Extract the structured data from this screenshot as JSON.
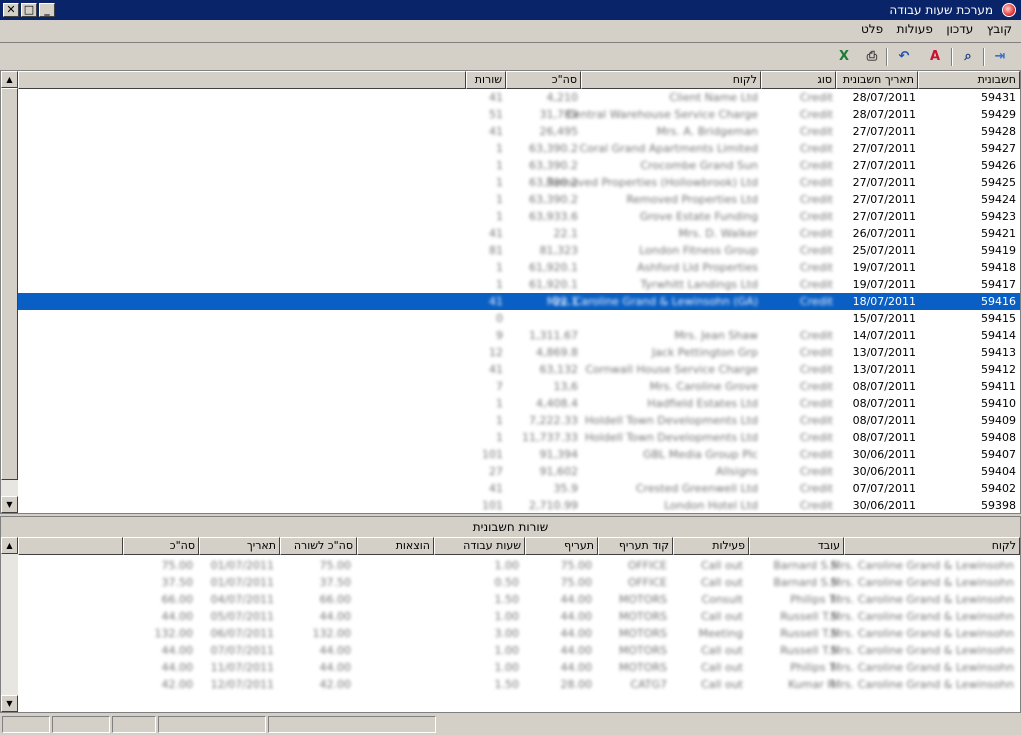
{
  "window": {
    "title": "מערכת שעות עבודה",
    "buttons": {
      "close": "✕",
      "maximize": "□",
      "minimize": "_"
    }
  },
  "menu": [
    "קובץ",
    "עדכון",
    "פעולות",
    "פלט"
  ],
  "toolbar": {
    "buttons": [
      {
        "name": "exit-icon",
        "glyph": "⇥",
        "color": "#3a6fc7"
      },
      {
        "name": "binoculars-icon",
        "glyph": "⌕",
        "color": "#1d3f7a"
      },
      {
        "name": "pdf-icon",
        "glyph": "A",
        "color": "#c8102e"
      },
      {
        "name": "undo-icon",
        "glyph": "↶",
        "color": "#1f4fb0"
      },
      {
        "name": "print-icon",
        "glyph": "⎙",
        "color": "#444444"
      },
      {
        "name": "excel-icon",
        "glyph": "X",
        "color": "#1e7b34"
      }
    ]
  },
  "invoices": {
    "columns": [
      "חשבונית",
      "תאריך חשבונית",
      "סוג",
      "לקוח",
      "סה\"כ",
      "שורות"
    ],
    "rows": [
      {
        "number": "59431",
        "date": "28/07/2011",
        "type": "Credit",
        "customer": "Client Name Ltd",
        "total": "4,210",
        "lines": "41"
      },
      {
        "number": "59429",
        "date": "28/07/2011",
        "type": "Credit",
        "customer": "Central Warehouse Service Charge",
        "total": "31,789",
        "lines": "51"
      },
      {
        "number": "59428",
        "date": "27/07/2011",
        "type": "Credit",
        "customer": "Mrs. A. Bridgeman",
        "total": "26,495",
        "lines": "41"
      },
      {
        "number": "59427",
        "date": "27/07/2011",
        "type": "Credit",
        "customer": "Coral Grand Apartments Limited",
        "total": "63,390.2",
        "lines": "1"
      },
      {
        "number": "59426",
        "date": "27/07/2011",
        "type": "Credit",
        "customer": "Crocombe Grand Sun",
        "total": "63,390.2",
        "lines": "1"
      },
      {
        "number": "59425",
        "date": "27/07/2011",
        "type": "Credit",
        "customer": "Removed Properties (Hollowbrook) Ltd",
        "total": "63,390.2",
        "lines": "1"
      },
      {
        "number": "59424",
        "date": "27/07/2011",
        "type": "Credit",
        "customer": "Removed Properties Ltd",
        "total": "63,390.2",
        "lines": "1"
      },
      {
        "number": "59423",
        "date": "27/07/2011",
        "type": "Credit",
        "customer": "Grove Estate Funding",
        "total": "63,933.6",
        "lines": "1"
      },
      {
        "number": "59421",
        "date": "26/07/2011",
        "type": "Credit",
        "customer": "Mrs. D. Walker",
        "total": "22.1",
        "lines": "41"
      },
      {
        "number": "59419",
        "date": "25/07/2011",
        "type": "Credit",
        "customer": "London Fitness Group",
        "total": "81,323",
        "lines": "81"
      },
      {
        "number": "59418",
        "date": "19/07/2011",
        "type": "Credit",
        "customer": "Ashford Lld Properties",
        "total": "61,920.1",
        "lines": "1"
      },
      {
        "number": "59417",
        "date": "19/07/2011",
        "type": "Credit",
        "customer": "Tyrwhitt Landings Ltd",
        "total": "61,920.1",
        "lines": "1"
      },
      {
        "number": "59416",
        "date": "18/07/2011",
        "type": "Credit",
        "customer": "Mrs. Caroline Grand & Lewinsohn (GA)",
        "total": "22.1",
        "lines": "41"
      },
      {
        "number": "59415",
        "date": "15/07/2011",
        "type": "",
        "customer": "",
        "total": "",
        "lines": "0"
      },
      {
        "number": "59414",
        "date": "14/07/2011",
        "type": "Credit",
        "customer": "Mrs. Jean Shaw",
        "total": "1,311.67",
        "lines": "9"
      },
      {
        "number": "59413",
        "date": "13/07/2011",
        "type": "Credit",
        "customer": "Jack Pettington Grp",
        "total": "4,869.8",
        "lines": "12"
      },
      {
        "number": "59412",
        "date": "13/07/2011",
        "type": "Credit",
        "customer": "Cornwall House Service Charge",
        "total": "63,132",
        "lines": "41"
      },
      {
        "number": "59411",
        "date": "08/07/2011",
        "type": "Credit",
        "customer": "Mrs. Caroline Grove",
        "total": "13,6",
        "lines": "7"
      },
      {
        "number": "59410",
        "date": "08/07/2011",
        "type": "Credit",
        "customer": "Hadfield Estates Ltd",
        "total": "4,408.4",
        "lines": "1"
      },
      {
        "number": "59409",
        "date": "08/07/2011",
        "type": "Credit",
        "customer": "Holdell Town Developments Ltd",
        "total": "7,222.33",
        "lines": "1"
      },
      {
        "number": "59408",
        "date": "08/07/2011",
        "type": "Credit",
        "customer": "Holdell Town Developments Ltd",
        "total": "11,737.33",
        "lines": "1"
      },
      {
        "number": "59407",
        "date": "30/06/2011",
        "type": "Credit",
        "customer": "GBL Media Group Plc",
        "total": "91,394",
        "lines": "101"
      },
      {
        "number": "59404",
        "date": "30/06/2011",
        "type": "Credit",
        "customer": "Allsigns",
        "total": "91,602",
        "lines": "27"
      },
      {
        "number": "59402",
        "date": "07/07/2011",
        "type": "Credit",
        "customer": "Crested Greenwell Ltd",
        "total": "35.9",
        "lines": "41"
      },
      {
        "number": "59398",
        "date": "30/06/2011",
        "type": "Credit",
        "customer": "London Hotel Ltd",
        "total": "2,710.99",
        "lines": "101"
      }
    ]
  },
  "lines": {
    "title": "שורות חשבונית",
    "columns": [
      "לקוח",
      "עובד",
      "פעילות",
      "קוד תעריף",
      "תעריף",
      "שעות עבודה",
      "הוצאות",
      "סה\"כ לשורה",
      "תאריך",
      "סה\"כ"
    ],
    "rows": [
      {
        "customer": "Mrs. Caroline Grand & Lewinsohn",
        "worker": "Barnard S.S",
        "activity": "Call out",
        "rate_code": "OFFICE",
        "rate": "75.00",
        "hours": "1.00",
        "expenses": "",
        "line_total": "75.00",
        "date": "01/07/2011",
        "total": "75.00"
      },
      {
        "customer": "Mrs. Caroline Grand & Lewinsohn",
        "worker": "Barnard S.S",
        "activity": "Call out",
        "rate_code": "OFFICE",
        "rate": "75.00",
        "hours": "0.50",
        "expenses": "",
        "line_total": "37.50",
        "date": "01/07/2011",
        "total": "37.50"
      },
      {
        "customer": "Mrs. Caroline Grand & Lewinsohn",
        "worker": "Philips T.",
        "activity": "Consult",
        "rate_code": "MOTORS",
        "rate": "44.00",
        "hours": "1.50",
        "expenses": "",
        "line_total": "66.00",
        "date": "04/07/2011",
        "total": "66.00"
      },
      {
        "customer": "Mrs. Caroline Grand & Lewinsohn",
        "worker": "Russell T.S",
        "activity": "Call out",
        "rate_code": "MOTORS",
        "rate": "44.00",
        "hours": "1.00",
        "expenses": "",
        "line_total": "44.00",
        "date": "05/07/2011",
        "total": "44.00"
      },
      {
        "customer": "Mrs. Caroline Grand & Lewinsohn",
        "worker": "Russell T.S",
        "activity": "Meeting",
        "rate_code": "MOTORS",
        "rate": "44.00",
        "hours": "3.00",
        "expenses": "",
        "line_total": "132.00",
        "date": "06/07/2011",
        "total": "132.00"
      },
      {
        "customer": "Mrs. Caroline Grand & Lewinsohn",
        "worker": "Russell T.S",
        "activity": "Call out",
        "rate_code": "MOTORS",
        "rate": "44.00",
        "hours": "1.00",
        "expenses": "",
        "line_total": "44.00",
        "date": "07/07/2011",
        "total": "44.00"
      },
      {
        "customer": "Mrs. Caroline Grand & Lewinsohn",
        "worker": "Philips T.",
        "activity": "Call out",
        "rate_code": "MOTORS",
        "rate": "44.00",
        "hours": "1.00",
        "expenses": "",
        "line_total": "44.00",
        "date": "11/07/2011",
        "total": "44.00"
      },
      {
        "customer": "Mrs. Caroline Grand & Lewinsohn",
        "worker": "Kumar R.",
        "activity": "Call out",
        "rate_code": "CATG7",
        "rate": "28.00",
        "hours": "1.50",
        "expenses": "",
        "line_total": "42.00",
        "date": "12/07/2011",
        "total": "42.00"
      }
    ]
  },
  "colors": {
    "titlebar": "#0a246a",
    "selection": "#0a5fc4"
  }
}
